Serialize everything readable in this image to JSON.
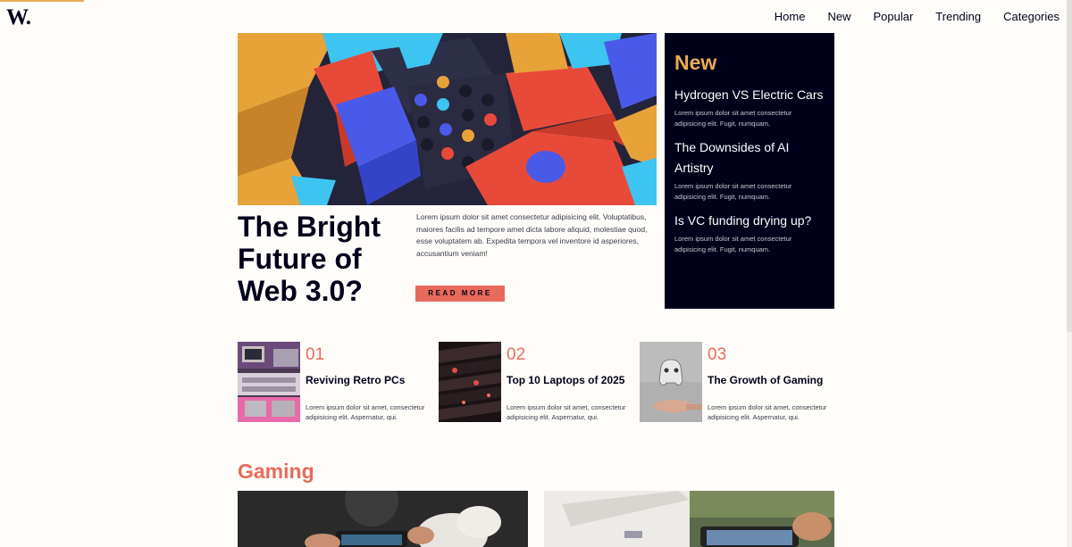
{
  "header": {
    "logo": "W.",
    "nav": [
      "Home",
      "New",
      "Popular",
      "Trending",
      "Categories"
    ]
  },
  "hero": {
    "title": "The Bright Future of Web 3.0?",
    "text": "Lorem ipsum dolor sit amet consectetur adipisicing elit. Voluptatibus, maiores facilis ad tempore amet dicta labore aliquid, molestiae quod, esse voluptatem ab. Expedita tempora vel inventore id asperiores, accusantium veniam!",
    "button": "READ MORE"
  },
  "new_panel": {
    "heading": "New",
    "items": [
      {
        "title": "Hydrogen VS Electric Cars",
        "text": "Lorem ipsum dolor sit amet consectetur adipisicing elit. Fugit, numquam."
      },
      {
        "title": "The Downsides of AI Artistry",
        "text": "Lorem ipsum dolor sit amet consectetur adipisicing elit. Fugit, numquam."
      },
      {
        "title": "Is VC funding drying up?",
        "text": "Lorem ipsum dolor sit amet consectetur adipisicing elit. Fugit, numquam."
      }
    ]
  },
  "cards": [
    {
      "num": "01",
      "title": "Reviving Retro PCs",
      "text": "Lorem ipsum dolor sit amet, consectetur adipisicing elit. Aspernatur, qui."
    },
    {
      "num": "02",
      "title": "Top 10 Laptops of 2025",
      "text": "Lorem ipsum dolor sit amet, consectetur adipisicing elit. Aspernatur, qui."
    },
    {
      "num": "03",
      "title": "The Growth of Gaming",
      "text": "Lorem ipsum dolor sit amet, consectetur adipisicing elit. Aspernatur, qui."
    }
  ],
  "gaming": {
    "title": "Gaming"
  },
  "colors": {
    "accent_orange": "#e9ab53",
    "accent_red": "#e86a5a",
    "navy": "#00001a",
    "background": "#fffdf9"
  }
}
